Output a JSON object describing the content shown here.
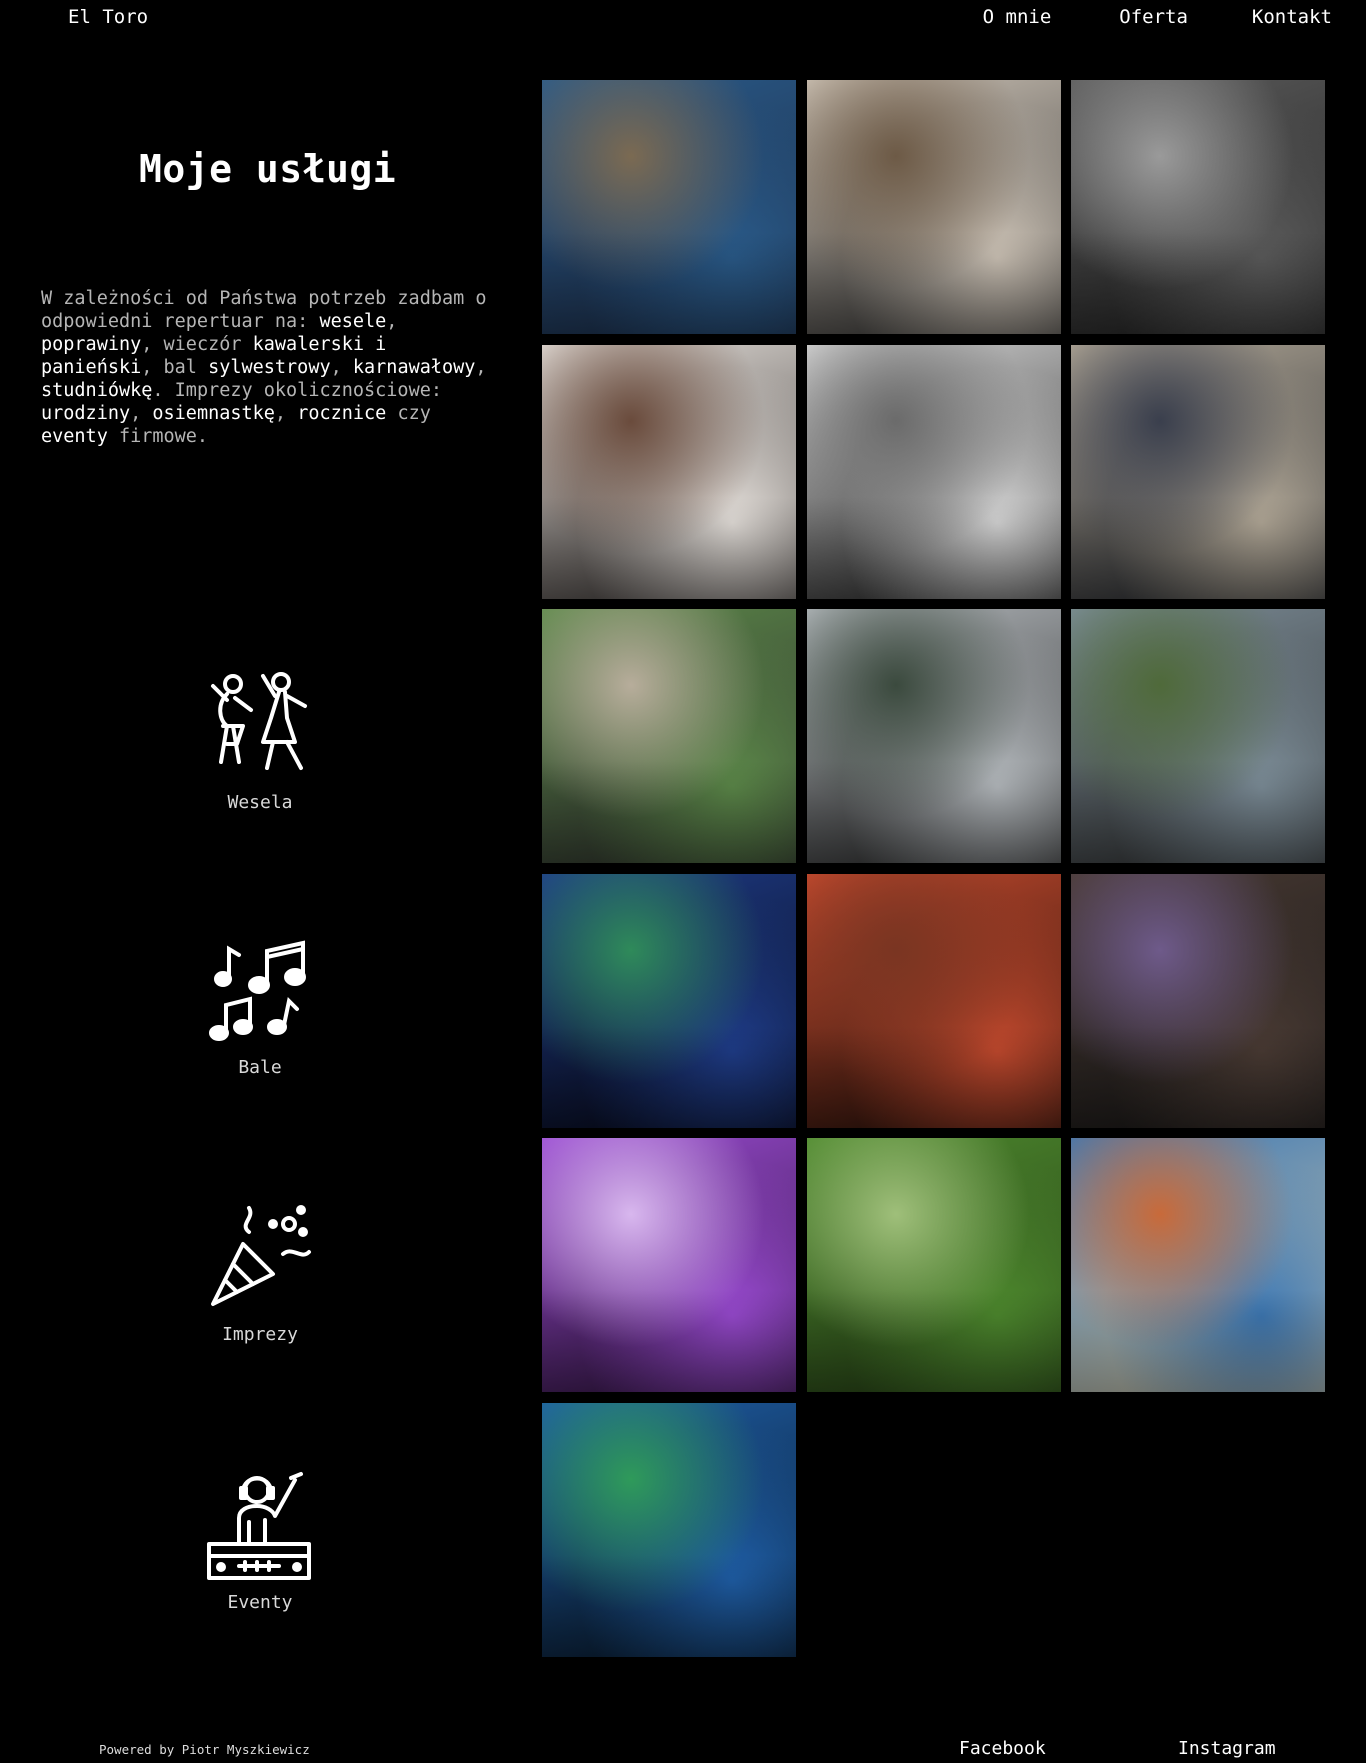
{
  "header": {
    "brand": "El Toro",
    "nav": [
      "O mnie",
      "Oferta",
      "Kontakt"
    ]
  },
  "main": {
    "title": "Moje usługi",
    "intro": [
      {
        "t": "W zależności od Państwa potrzeb zadbam o odpowiedni repertuar na: ",
        "b": false
      },
      {
        "t": "wesele",
        "b": true
      },
      {
        "t": ", ",
        "b": false
      },
      {
        "t": "poprawiny",
        "b": true
      },
      {
        "t": ", wieczór ",
        "b": false
      },
      {
        "t": "kawalerski i panieński",
        "b": true
      },
      {
        "t": ", bal ",
        "b": false
      },
      {
        "t": "sylwestrowy",
        "b": true
      },
      {
        "t": ", ",
        "b": false
      },
      {
        "t": "karnawałowy",
        "b": true
      },
      {
        "t": ", ",
        "b": false
      },
      {
        "t": "studniówkę",
        "b": true
      },
      {
        "t": ". Imprezy okolicznościowe: ",
        "b": false
      },
      {
        "t": "urodziny",
        "b": true
      },
      {
        "t": ", ",
        "b": false
      },
      {
        "t": "osiemnastkę",
        "b": true
      },
      {
        "t": ", ",
        "b": false
      },
      {
        "t": "rocznice",
        "b": true
      },
      {
        "t": " czy ",
        "b": false
      },
      {
        "t": "eventy",
        "b": true
      },
      {
        "t": " firmowe.",
        "b": false
      }
    ],
    "services": [
      {
        "label": "Wesela",
        "icon": "dancing-couple-icon"
      },
      {
        "label": "Bale",
        "icon": "music-notes-icon"
      },
      {
        "label": "Imprezy",
        "icon": "party-popper-icon"
      },
      {
        "label": "Eventy",
        "icon": "dj-console-icon"
      }
    ]
  },
  "gallery": {
    "photos": [
      {
        "name": "photo-dj-redbull-booth",
        "colors": [
          "#2a5b8a",
          "#7b6a52",
          "#1b2a44"
        ]
      },
      {
        "name": "photo-dj-white-shirt",
        "colors": [
          "#cfc5b8",
          "#6d5a46",
          "#2b2b2b"
        ]
      },
      {
        "name": "photo-dj-monochrome-party",
        "colors": [
          "#5c5c5c",
          "#9a9a9a",
          "#1e1e1e"
        ]
      },
      {
        "name": "photo-moschino-hm-booth",
        "colors": [
          "#e7e2dd",
          "#6a4b3c",
          "#2f2a28"
        ]
      },
      {
        "name": "photo-headphones-closeup",
        "colors": [
          "#d8d8d8",
          "#6b6b6b",
          "#191919"
        ]
      },
      {
        "name": "photo-mixer-knobs",
        "colors": [
          "#b4aa99",
          "#3a3f4d",
          "#1a1e25"
        ]
      },
      {
        "name": "photo-outdoor-dj-set",
        "colors": [
          "#5d8a4a",
          "#b7ad9b",
          "#2a2a2a"
        ]
      },
      {
        "name": "photo-film-crew",
        "colors": [
          "#b7bcc0",
          "#3b4a3e",
          "#202020"
        ]
      },
      {
        "name": "photo-mountain-selfie",
        "colors": [
          "#7e8f9a",
          "#4f6a3a",
          "#2c2c2c"
        ]
      },
      {
        "name": "photo-conference-stage",
        "colors": [
          "#1f3d8a",
          "#2f8a5a",
          "#050510"
        ]
      },
      {
        "name": "photo-banquet-hall-dj",
        "colors": [
          "#c44a2e",
          "#7a3522",
          "#1b0d08"
        ]
      },
      {
        "name": "photo-dj-saxophone",
        "colors": [
          "#4a3b34",
          "#6e5a8a",
          "#141414"
        ]
      },
      {
        "name": "photo-birthday-cake-sparklers",
        "colors": [
          "#9a4bd2",
          "#d8b7ee",
          "#2b1238"
        ]
      },
      {
        "name": "photo-love-letters-garden",
        "colors": [
          "#4e8a2e",
          "#9fbf7a",
          "#233a14"
        ]
      },
      {
        "name": "photo-sports-hall-event",
        "colors": [
          "#3e79b5",
          "#c86a3a",
          "#d4c9a8"
        ]
      },
      {
        "name": "photo-blue-conference-seats",
        "colors": [
          "#1f5fa8",
          "#2f9a5a",
          "#071422"
        ]
      }
    ]
  },
  "footer": {
    "powered": "Powered by Piotr Myszkiewicz",
    "facebook": "Facebook",
    "instagram": "Instagram"
  }
}
